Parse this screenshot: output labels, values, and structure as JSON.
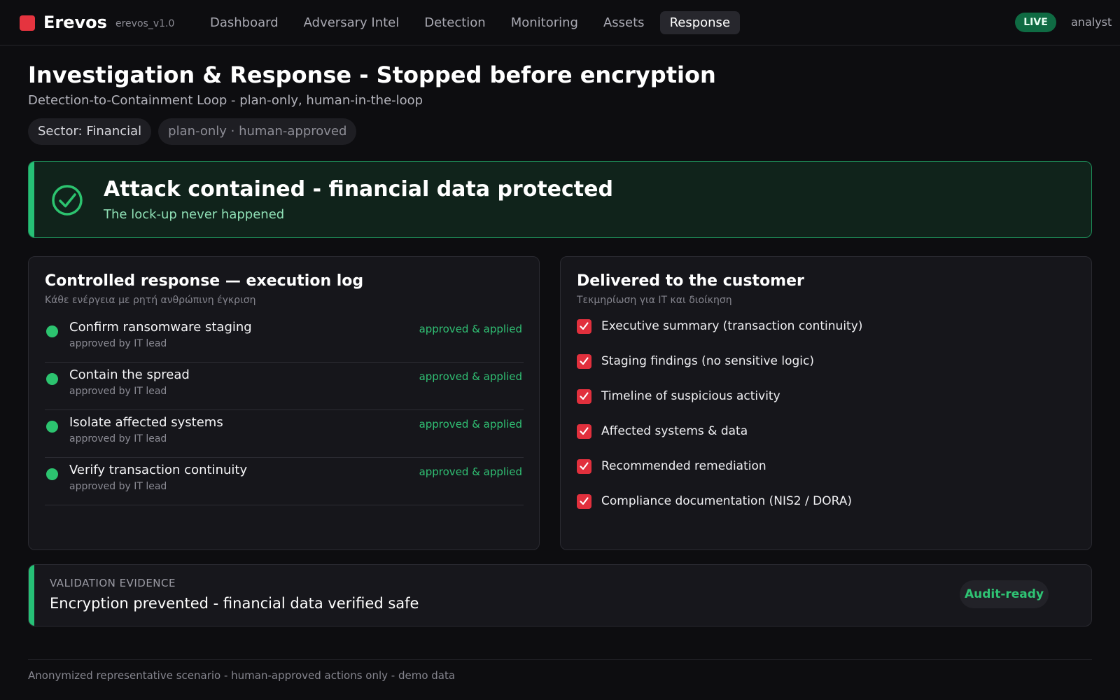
{
  "app": {
    "brand": "Erevos",
    "version": "erevos_v1.0",
    "brand_color": "#e5343f"
  },
  "nav": {
    "items": [
      {
        "label": "Dashboard",
        "active": false
      },
      {
        "label": "Adversary Intel",
        "active": false
      },
      {
        "label": "Detection",
        "active": false
      },
      {
        "label": "Monitoring",
        "active": false
      },
      {
        "label": "Assets",
        "active": false
      },
      {
        "label": "Response",
        "active": true
      }
    ],
    "live_badge": "LIVE",
    "user": "analyst"
  },
  "page": {
    "title": "Investigation & Response - Stopped before encryption",
    "subtitle": "Detection-to-Containment Loop - plan-only, human-in-the-loop",
    "chips": {
      "sector": "Sector: Financial",
      "mode": "plan-only · human-approved"
    }
  },
  "banner": {
    "icon": "check-circle-icon",
    "title": "Attack contained - financial data protected",
    "subtitle": "The lock-up never happened",
    "color": "#26c076"
  },
  "execution_log": {
    "title": "Controlled response — execution log",
    "subtitle": "Κάθε ενέργεια με ρητή ανθρώπινη έγκριση",
    "items": [
      {
        "title": "Confirm ransomware staging",
        "meta": "approved by IT lead",
        "status": "approved & applied"
      },
      {
        "title": "Contain the spread",
        "meta": "approved by IT lead",
        "status": "approved & applied"
      },
      {
        "title": "Isolate affected systems",
        "meta": "approved by IT lead",
        "status": "approved & applied"
      },
      {
        "title": "Verify transaction continuity",
        "meta": "approved by IT lead",
        "status": "approved & applied"
      }
    ]
  },
  "delivered": {
    "title": "Delivered to the customer",
    "subtitle": "Τεκμηρίωση για IT και διοίκηση",
    "items": [
      {
        "label": "Executive summary (transaction continuity)",
        "checked": true
      },
      {
        "label": "Staging findings (no sensitive logic)",
        "checked": true
      },
      {
        "label": "Timeline of suspicious activity",
        "checked": true
      },
      {
        "label": "Affected systems & data",
        "checked": true
      },
      {
        "label": "Recommended remediation",
        "checked": true
      },
      {
        "label": "Compliance documentation (NIS2 / DORA)",
        "checked": true
      }
    ]
  },
  "evidence": {
    "label": "VALIDATION EVIDENCE",
    "text": "Encryption prevented - financial data verified safe",
    "badge": "Audit-ready"
  },
  "footer": {
    "text": "Anonymized representative scenario - human-approved actions only - demo data"
  }
}
